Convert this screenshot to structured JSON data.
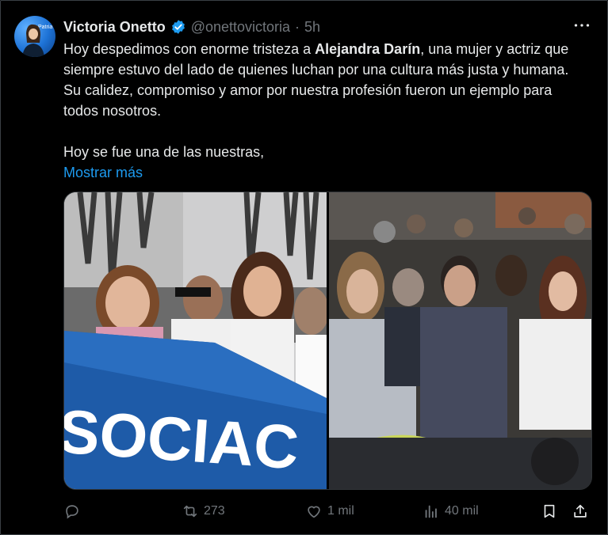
{
  "post": {
    "author_name": "Victoria Onetto",
    "handle": "@onettovictoria",
    "separator": "·",
    "time": "5h",
    "avatar_text": "Patria",
    "text_part1": "Hoy despedimos con enorme tristeza a ",
    "text_bold": "Alejandra Darín",
    "text_part2": ", una mujer y actriz que siempre estuvo del lado de quienes luchan por una cultura más justa y humana. Su calidez, compromiso y amor por nuestra profesión fueron un ejemplo para todos nosotros.",
    "text_line2": "Hoy se fue una de las nuestras,",
    "show_more": "Mostrar más",
    "banner_text": "SOCIAC"
  },
  "actions": {
    "reply_count": "",
    "retweet_count": "273",
    "like_count": "1 mil",
    "views_count": "40 mil"
  },
  "colors": {
    "background": "#000000",
    "text": "#e7e9ea",
    "muted": "#71767b",
    "link": "#1d9bf0",
    "verified": "#1d9bf0"
  },
  "icons": [
    "more-icon",
    "verified-icon",
    "reply-icon",
    "retweet-icon",
    "like-icon",
    "views-icon",
    "bookmark-icon",
    "share-icon"
  ]
}
